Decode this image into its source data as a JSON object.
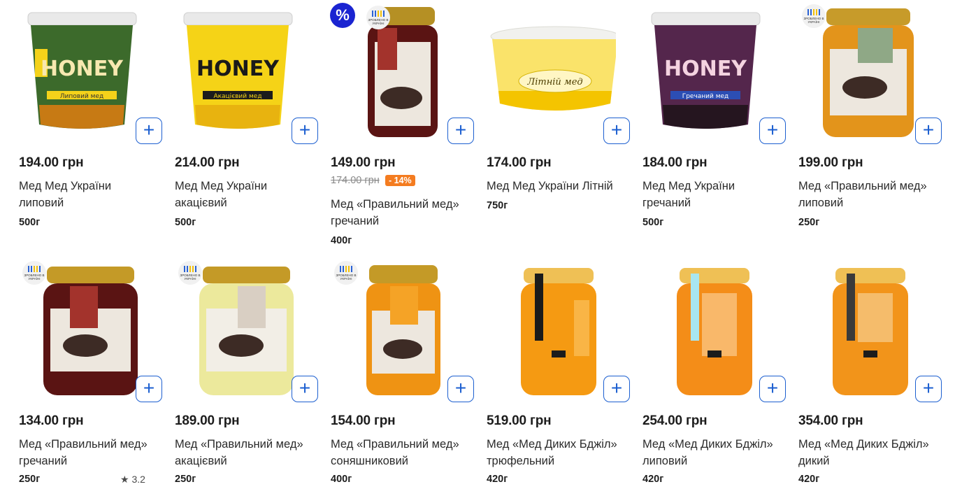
{
  "colors": {
    "accent": "#1c5fd0",
    "discount": "#f47c20",
    "promo_badge": "#1a24d1"
  },
  "badges": {
    "ua_text": "ЗРОБЛЕНО В УКРАЇНІ",
    "promo_symbol": "%"
  },
  "add_label": "+",
  "products": [
    {
      "price": "194.00 грн",
      "name": "Мед Мед України липовий",
      "weight": "500г",
      "label": "HONEY",
      "sublabel": "Липовий мед",
      "icon": "honey-tub-green-icon"
    },
    {
      "price": "214.00 грн",
      "name": "Мед Мед України акацієвий",
      "weight": "500г",
      "label": "HONEY",
      "sublabel": "Акацієвий мед",
      "icon": "honey-tub-yellow-icon"
    },
    {
      "price": "149.00 грн",
      "old_price": "174.00 грн",
      "discount": "- 14%",
      "name": "Мед «Правильний мед» гречаний",
      "weight": "400г",
      "icon": "honey-jar-dark-icon"
    },
    {
      "price": "174.00 грн",
      "name": "Мед Мед України Літній",
      "weight": "750г",
      "label": "Літній мед",
      "icon": "honey-tub-cream-icon"
    },
    {
      "price": "184.00 грн",
      "name": "Мед Мед України гречаний",
      "weight": "500г",
      "label": "HONEY",
      "sublabel": "Гречаний мед",
      "icon": "honey-tub-purple-icon"
    },
    {
      "price": "199.00 грн",
      "name": "Мед «Правильний мед» липовий",
      "weight": "250г",
      "icon": "honey-jar-amber-icon"
    },
    {
      "price": "134.00 грн",
      "name": "Мед «Правильний мед» гречаний",
      "weight": "250г",
      "rating": "★ 3.2",
      "icon": "honey-jar-dark-icon"
    },
    {
      "price": "189.00 грн",
      "name": "Мед «Правильний мед» акацієвий",
      "weight": "250г",
      "icon": "honey-jar-light-icon"
    },
    {
      "price": "154.00 грн",
      "name": "Мед «Правильний мед» соняшниковий",
      "weight": "400г",
      "icon": "honey-jar-orange-icon"
    },
    {
      "price": "519.00 грн",
      "name": "Мед «Мед Диких Бджіл» трюфельний",
      "weight": "420г",
      "icon": "honey-jar-wild-icon"
    },
    {
      "price": "254.00 грн",
      "name": "Мед «Мед Диких Бджіл» липовий",
      "weight": "420г",
      "icon": "honey-jar-wild-icon"
    },
    {
      "price": "354.00 грн",
      "name": "Мед «Мед Диких Бджіл» дикий",
      "weight": "420г",
      "icon": "honey-jar-wild-icon"
    }
  ]
}
